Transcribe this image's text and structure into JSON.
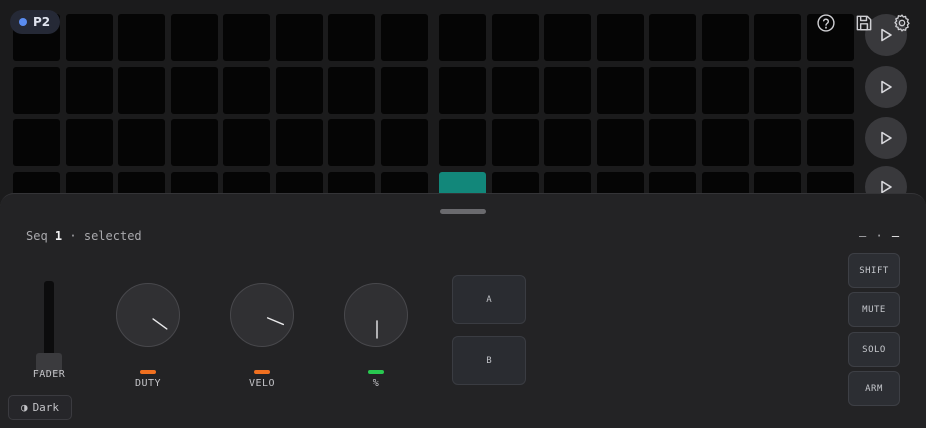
{
  "header": {
    "page_label": "P2"
  },
  "grid": {
    "rows": 4,
    "cols": 16,
    "active_cells": [
      [
        3,
        8
      ]
    ]
  },
  "colors": {
    "active_cell": "#12877a",
    "page_dot": "#5a8cf0",
    "led_orange": "#f07020",
    "led_green": "#28c850"
  },
  "icons": {
    "help": "help-circle-icon",
    "save": "save-icon",
    "settings": "gear-icon",
    "play": "play-icon"
  },
  "panel": {
    "status_prefix": "Seq",
    "status_number": "1",
    "status_suffix": "· selected",
    "status_right_dim": "– ·",
    "status_right_bright": "–",
    "fader_label": "FADER",
    "fader_value": 0.05,
    "knobs": [
      {
        "label": "DUTY",
        "value": 0.7,
        "led": "orange"
      },
      {
        "label": "VELO",
        "value": 0.75,
        "led": "orange"
      },
      {
        "label": "%",
        "value": 0.5,
        "led": "green"
      }
    ],
    "pads": [
      "A",
      "B"
    ],
    "side_buttons": [
      "SHIFT",
      "MUTE",
      "SOLO",
      "ARM"
    ],
    "theme_icon": "◑",
    "theme_label": "Dark"
  }
}
